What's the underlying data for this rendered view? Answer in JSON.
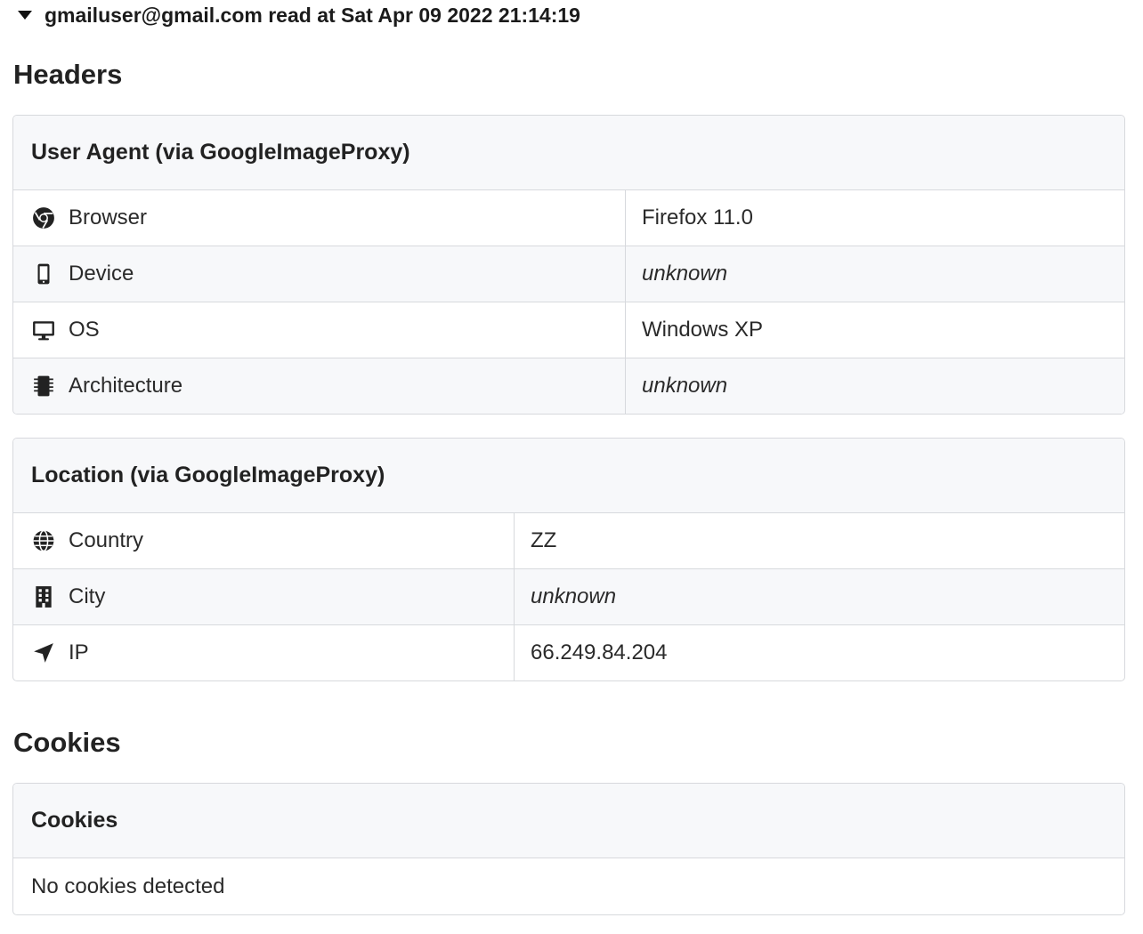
{
  "summary": {
    "text": "gmailuser@gmail.com read at Sat Apr 09 2022 21:14:19"
  },
  "headers_section": {
    "title": "Headers"
  },
  "user_agent_card": {
    "title": "User Agent (via GoogleImageProxy)",
    "rows": [
      {
        "icon": "chrome-icon",
        "label": "Browser",
        "value": "Firefox 11.0"
      },
      {
        "icon": "mobile-phone-icon",
        "label": "Device",
        "value": "unknown"
      },
      {
        "icon": "desktop-monitor-icon",
        "label": "OS",
        "value": "Windows XP"
      },
      {
        "icon": "microchip-icon",
        "label": "Architecture",
        "value": "unknown"
      }
    ]
  },
  "location_card": {
    "title": "Location (via GoogleImageProxy)",
    "rows": [
      {
        "icon": "globe-icon",
        "label": "Country",
        "value": "ZZ"
      },
      {
        "icon": "building-icon",
        "label": "City",
        "value": "unknown"
      },
      {
        "icon": "location-arrow-icon",
        "label": "IP",
        "value": "66.249.84.204"
      }
    ]
  },
  "cookies_section": {
    "title": "Cookies"
  },
  "cookies_card": {
    "title": "Cookies",
    "message": "No cookies detected"
  }
}
